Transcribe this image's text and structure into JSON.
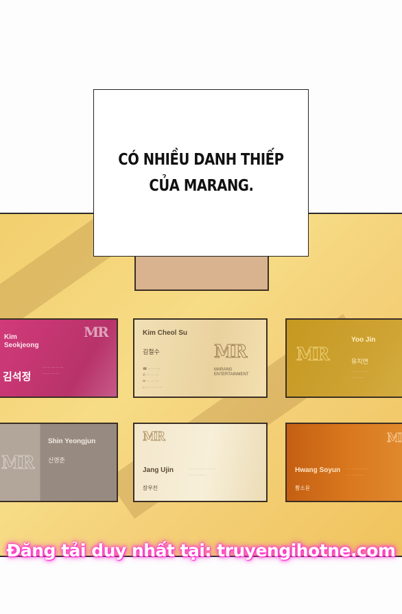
{
  "caption": {
    "line1": "CÓ NHIỀU DANH THIẾP",
    "line2": "CỦA MARANG."
  },
  "cards": {
    "kim_seokjeong": {
      "name_line1": "Kim",
      "name_line2": "Seokjeong",
      "korean": "김석정",
      "logo": "MR"
    },
    "kim_cheol_su": {
      "name": "Kim Cheol Su",
      "korean": "김철수",
      "logo": "MR",
      "company_line1": "MARANG",
      "company_line2": "ENTERTAINMENT"
    },
    "yoo_jin": {
      "name": "Yoo Jin",
      "korean": "유지연",
      "logo": "MR"
    },
    "shin_yeongjun": {
      "name": "Shin Yeongjun",
      "korean": "신영준",
      "logo": "MR"
    },
    "jang_ujin": {
      "name": "Jang Ujin",
      "korean": "장우진",
      "logo": "MR"
    },
    "hwang_soyun": {
      "name": "Hwang Soyun",
      "korean": "황소윤",
      "logo": "MR"
    }
  },
  "watermark": "Đăng tải duy nhất tại: truyengihotne.com",
  "colors": {
    "panel_bg": "#f4d17a",
    "pink_card": "#c8376e",
    "gold_card": "#c99a24",
    "orange_card": "#d7741b",
    "gray_card": "#9c8f86",
    "beige_card": "#e8d8b0",
    "watermark_glow": "#ff2fd2"
  }
}
